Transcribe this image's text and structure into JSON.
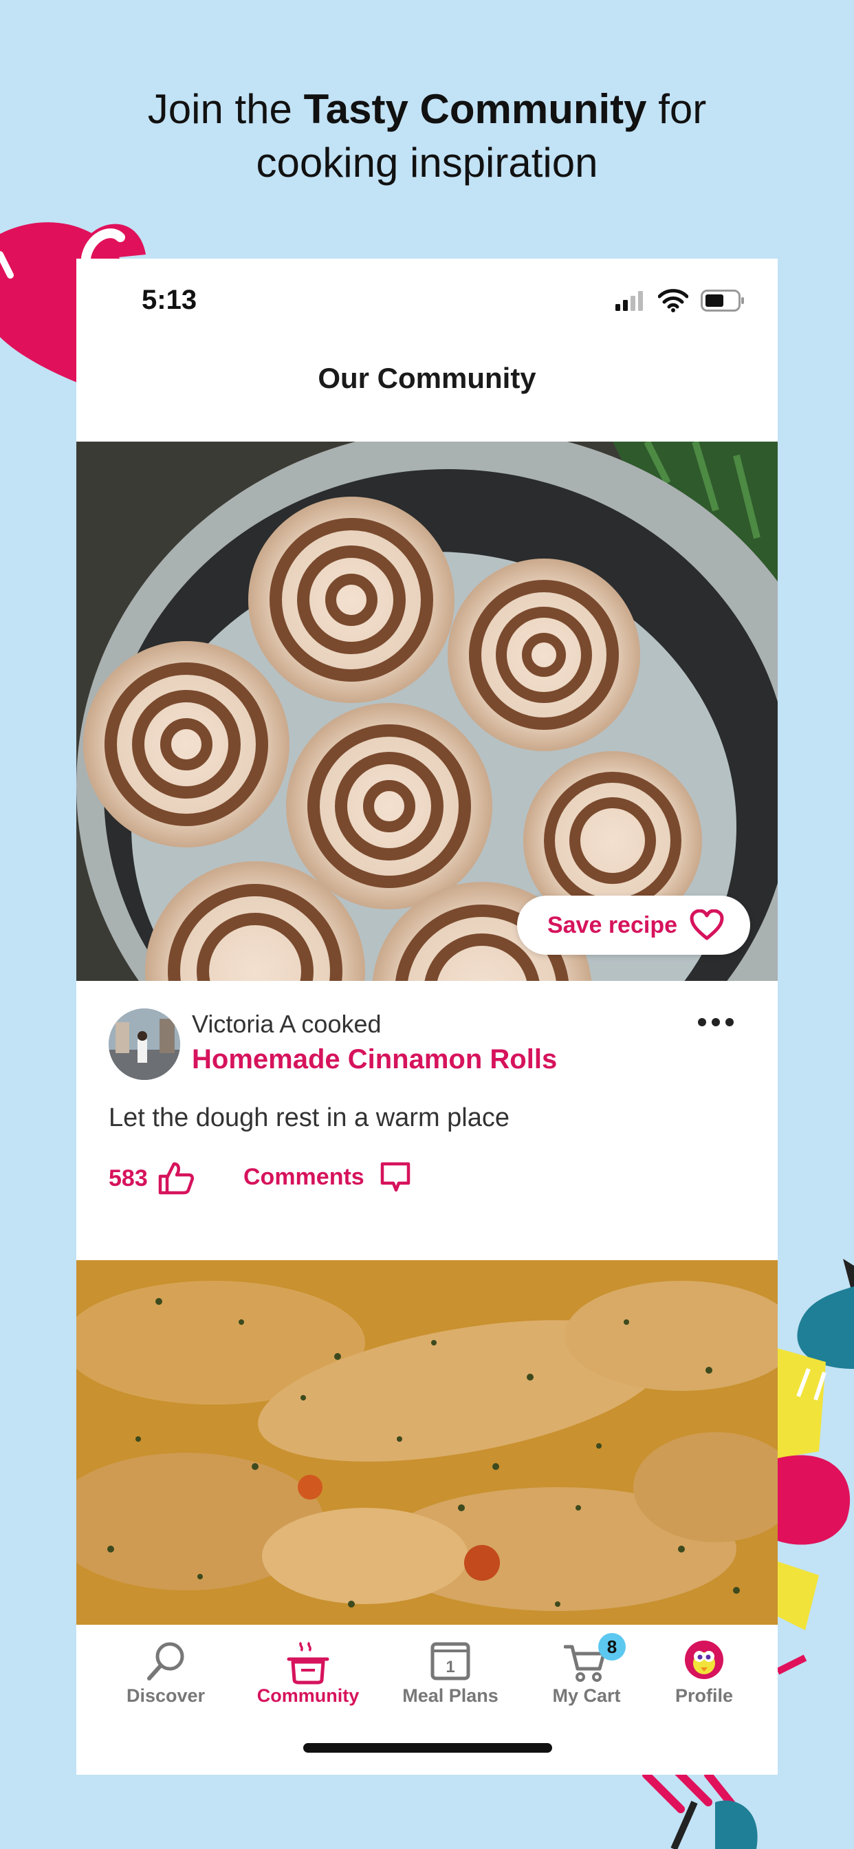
{
  "headline": {
    "prefix": "Join the ",
    "bold": "Tasty Community",
    "suffix": " for",
    "line2": "cooking inspiration"
  },
  "status_bar": {
    "time": "5:13"
  },
  "nav": {
    "title": "Our Community"
  },
  "posts": [
    {
      "save_label": "Save recipe",
      "author_action": "Victoria A cooked",
      "recipe_title": "Homemade Cinnamon Rolls",
      "caption": "Let the dough rest in a warm place",
      "likes": "583",
      "comments_label": "Comments"
    }
  ],
  "tabbar": {
    "tabs": [
      {
        "label": "Discover",
        "icon": "search-icon"
      },
      {
        "label": "Community",
        "icon": "pot-icon",
        "active": true
      },
      {
        "label": "Meal Plans",
        "icon": "calendar-icon"
      },
      {
        "label": "My Cart",
        "icon": "cart-icon",
        "badge": "8"
      },
      {
        "label": "Profile",
        "icon": "avatar-icon"
      }
    ]
  },
  "colors": {
    "background": "#c2e2f5",
    "accent": "#d6135c",
    "badge": "#5cc8f0"
  }
}
